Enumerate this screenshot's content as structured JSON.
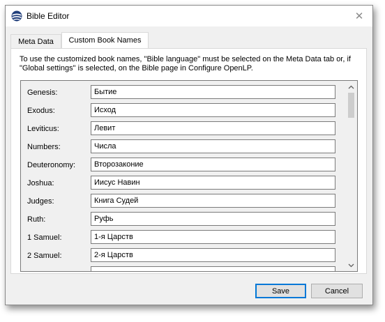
{
  "window": {
    "title": "Bible Editor",
    "close_glyph": "✕"
  },
  "tabs": [
    {
      "label": "Meta Data",
      "selected": false
    },
    {
      "label": "Custom Book Names",
      "selected": true
    }
  ],
  "info_text": "To use the customized book names, \"Bible language\" must be selected on the Meta Data tab or, if \"Global settings\" is selected, on the Bible page in Configure OpenLP.",
  "books": [
    {
      "label": "Genesis:",
      "value": "Бытие"
    },
    {
      "label": "Exodus:",
      "value": "Исход"
    },
    {
      "label": "Leviticus:",
      "value": "Левит"
    },
    {
      "label": "Numbers:",
      "value": "Числа"
    },
    {
      "label": "Deuteronomy:",
      "value": "Второзаконие"
    },
    {
      "label": "Joshua:",
      "value": "Иисус Навин"
    },
    {
      "label": "Judges:",
      "value": "Книга Судей"
    },
    {
      "label": "Ruth:",
      "value": "Руфь"
    },
    {
      "label": "1 Samuel:",
      "value": "1-я Царств"
    },
    {
      "label": "2 Samuel:",
      "value": "2-я Царств"
    },
    {
      "label": "",
      "value": ""
    }
  ],
  "buttons": {
    "save": "Save",
    "cancel": "Cancel"
  },
  "icons": {
    "app": "bible-globe-icon",
    "scroll_up": "chevron-up-icon",
    "scroll_down": "chevron-down-icon"
  },
  "colors": {
    "accent": "#0078d7",
    "window_bg": "#f0f0f0"
  }
}
